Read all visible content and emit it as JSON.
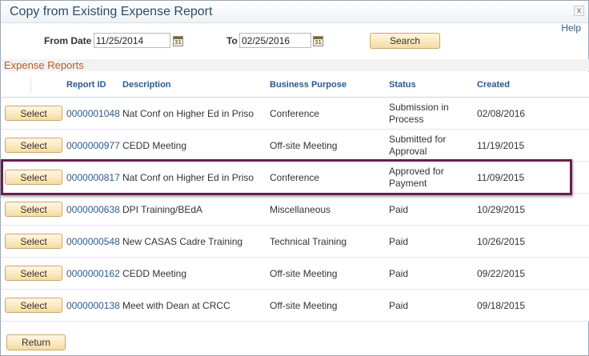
{
  "dialog": {
    "title": "Copy from Existing Expense Report",
    "close_glyph": "x",
    "help_label": "Help"
  },
  "search": {
    "from_label": "From Date",
    "from_value": "11/25/2014",
    "to_label": "To",
    "to_value": "02/25/2016",
    "calendar_glyph": "31",
    "search_label": "Search"
  },
  "grid": {
    "section_title": "Expense Reports",
    "headers": {
      "report_id": "Report ID",
      "description": "Description",
      "purpose": "Business Purpose",
      "status": "Status",
      "created": "Created"
    },
    "select_label": "Select",
    "rows": [
      {
        "report_id": "0000001048",
        "description": "Nat Conf on Higher Ed in Priso",
        "purpose": "Conference",
        "status_line1": "Submission in",
        "status_line2": "Process",
        "created": "02/08/2016"
      },
      {
        "report_id": "0000000977",
        "description": "CEDD Meeting",
        "purpose": "Off-site Meeting",
        "status_line1": "Submitted for",
        "status_line2": "Approval",
        "created": "11/19/2015"
      },
      {
        "report_id": "0000000817",
        "description": "Nat Conf on Higher Ed in Priso",
        "purpose": "Conference",
        "status_line1": "Approved for",
        "status_line2": "Payment",
        "created": "11/09/2015"
      },
      {
        "report_id": "0000000638",
        "description": "DPI Training/BEdA",
        "purpose": "Miscellaneous",
        "status_line1": "Paid",
        "status_line2": "",
        "created": "10/29/2015"
      },
      {
        "report_id": "0000000548",
        "description": "New CASAS Cadre Training",
        "purpose": "Technical Training",
        "status_line1": "Paid",
        "status_line2": "",
        "created": "10/26/2015"
      },
      {
        "report_id": "0000000162",
        "description": "CEDD Meeting",
        "purpose": "Off-site Meeting",
        "status_line1": "Paid",
        "status_line2": "",
        "created": "09/22/2015"
      },
      {
        "report_id": "0000000138",
        "description": "Meet with Dean at CRCC",
        "purpose": "Off-site Meeting",
        "status_line1": "Paid",
        "status_line2": "",
        "created": "09/18/2015"
      }
    ]
  },
  "footer": {
    "return_label": "Return"
  },
  "colors": {
    "accent_link": "#2b5a8c",
    "section_title": "#b65d26",
    "highlight_border": "#6b1e4a",
    "button_fill": "#f6dca4"
  }
}
